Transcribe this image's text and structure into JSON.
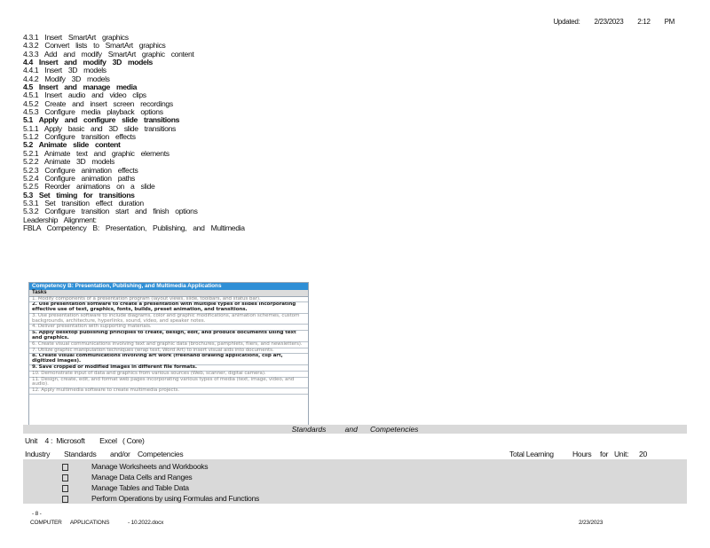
{
  "header": {
    "updated_label": "Updated:",
    "date": "2/23/2023",
    "time": "2:12",
    "ampm": "PM"
  },
  "outline": [
    {
      "text": "4.3.1 Insert SmartArt graphics",
      "bold": false
    },
    {
      "text": "4.3.2 Convert lists to SmartArt graphics",
      "bold": false
    },
    {
      "text": "4.3.3 Add and modify SmartArt graphic content",
      "bold": false
    },
    {
      "text": "4.4 Insert and modify 3D models",
      "bold": true
    },
    {
      "text": "4.4.1 Insert 3D models",
      "bold": false
    },
    {
      "text": "4.4.2 Modify 3D models",
      "bold": false
    },
    {
      "text": "4.5 Insert and manage media",
      "bold": true
    },
    {
      "text": "4.5.1 Insert audio and video clips",
      "bold": false
    },
    {
      "text": "4.5.2 Create and insert screen recordings",
      "bold": false
    },
    {
      "text": "4.5.3 Configure media playback options",
      "bold": false
    },
    {
      "text": "5.1 Apply and configure slide transitions",
      "bold": true
    },
    {
      "text": "5.1.1 Apply basic and 3D slide transitions",
      "bold": false
    },
    {
      "text": "5.1.2 Configure transition effects",
      "bold": false
    },
    {
      "text": "5.2 Animate slide content",
      "bold": true
    },
    {
      "text": "5.2.1 Animate text and graphic elements",
      "bold": false
    },
    {
      "text": "5.2.2 Animate 3D models",
      "bold": false
    },
    {
      "text": "5.2.3 Configure animation effects",
      "bold": false
    },
    {
      "text": "5.2.4 Configure animation paths",
      "bold": false
    },
    {
      "text": "5.2.5 Reorder animations on a slide",
      "bold": false
    },
    {
      "text": "5.3 Set timing for transitions",
      "bold": true
    },
    {
      "text": "5.3.1 Set transition effect duration",
      "bold": false
    },
    {
      "text": "5.3.2 Configure transition start and finish options",
      "bold": false
    },
    {
      "text": "Leadership Alignment:",
      "bold": false
    },
    {
      "text": "FBLA Competency B: Presentation, Publishing, and Multimedia",
      "bold": false
    }
  ],
  "table": {
    "title": "Competency B: Presentation, Publishing, and Multimedia Applications",
    "header": "Tasks",
    "tasks": [
      {
        "text": "1. Modify components of a presentation program (layout views, slide, toolbars, and status bar).",
        "style": "blur"
      },
      {
        "text": "2. Use presentation software to create a presentation with multiple types of slides incorporating effective use of text, graphics, fonts, builds, preset animation, and transitions.",
        "style": "bold"
      },
      {
        "text": "3. Use presentation software to include diagrams, color and graphic modifications, animation schemes, custom backgrounds, architecture, hyperlinks, sound, video, and speaker notes.",
        "style": "blur"
      },
      {
        "text": "4. Deliver presentation with supporting materials.",
        "style": "blur"
      },
      {
        "text": "5. Apply desktop publishing principles to create, design, edit, and produce documents using text and graphics.",
        "style": "bold"
      },
      {
        "text": "6. Create visual communications involving text and graphic data (brochures, pamphlets, fliers, and newsletters).",
        "style": "blur"
      },
      {
        "text": "7. Utilize graphic manipulation techniques (wrap text, Word Art) to insert visual aids into documents.",
        "style": "blur"
      },
      {
        "text": "8. Create visual communications involving art work (freehand drawing applications, clip art, digitized images).",
        "style": "bold"
      },
      {
        "text": "9. Save cropped or modified images in different file formats.",
        "style": "bold"
      },
      {
        "text": "10. Demonstrate input of data and graphics from various sources (Web, scanner, digital camera).",
        "style": "blur"
      },
      {
        "text": "11. Design, create, edit, and format web pages incorporating various types of media (text, image, video, and audio).",
        "style": "blur"
      },
      {
        "text": "12. Apply multimedia software to create multimedia projects.",
        "style": "blur"
      }
    ]
  },
  "band_title": {
    "left": "Standards",
    "mid": "and",
    "right": "Competencies"
  },
  "unit_line": {
    "unit": "Unit",
    "num": "4 :",
    "a": "Microsoft",
    "b": "Excel",
    "c": "( Core)"
  },
  "industry_line": {
    "industry": "Industry",
    "standards": "Standards",
    "andor": "and/or",
    "competencies": "Competencies",
    "total": "Total Learning",
    "hours": "Hours",
    "for": "for",
    "unit": "Unit:",
    "value": "20"
  },
  "items": [
    "Manage Worksheets and Workbooks",
    "Manage Data Cells and Ranges",
    "Manage Tables and Table Data",
    "Perform Operations by using Formulas and Functions"
  ],
  "footer": {
    "page": "- 8 -",
    "course": "COMPUTER APPLICATIONS",
    "doc": "- 10.2022.docx",
    "date": "2/23/2023"
  }
}
